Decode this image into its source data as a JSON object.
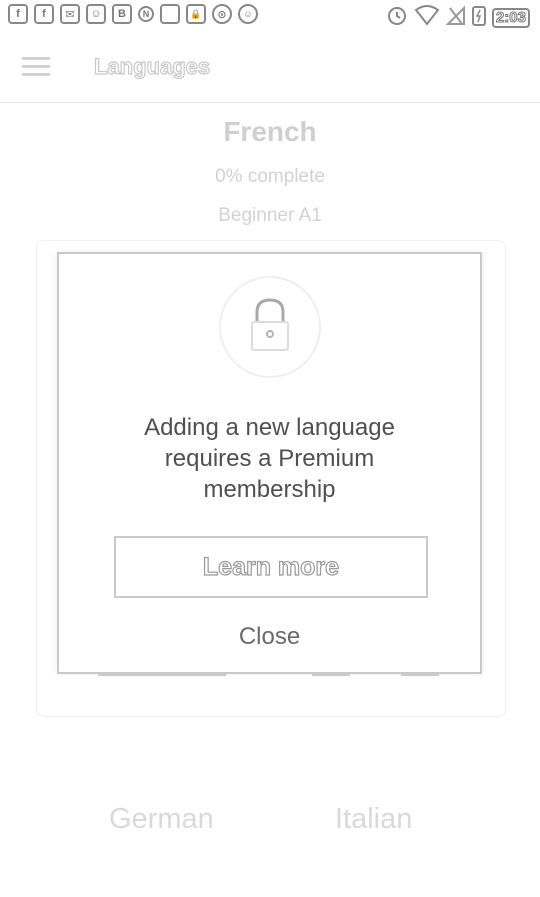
{
  "status_bar": {
    "left_icons": [
      "f",
      "f",
      "✉",
      "☺",
      "B",
      "N",
      "",
      "🔒",
      "⊙",
      "☺"
    ],
    "time": "2:03"
  },
  "app_bar": {
    "title": "Languages",
    "menu_icon": "hamburger-menu-icon"
  },
  "course": {
    "name": "French",
    "progress": "0% complete",
    "level": "Beginner A1"
  },
  "modal": {
    "icon": "lock-icon",
    "message_line1": "Adding a new language",
    "message_line2": "requires a Premium",
    "message_line3": "membership",
    "learn_more_label": "Learn more",
    "close_label": "Close"
  },
  "languages": [
    "German",
    "Italian"
  ],
  "colors": {
    "border": "#c9c9c9",
    "text_dark": "#505050",
    "text_faded": "#d2d2d2"
  }
}
